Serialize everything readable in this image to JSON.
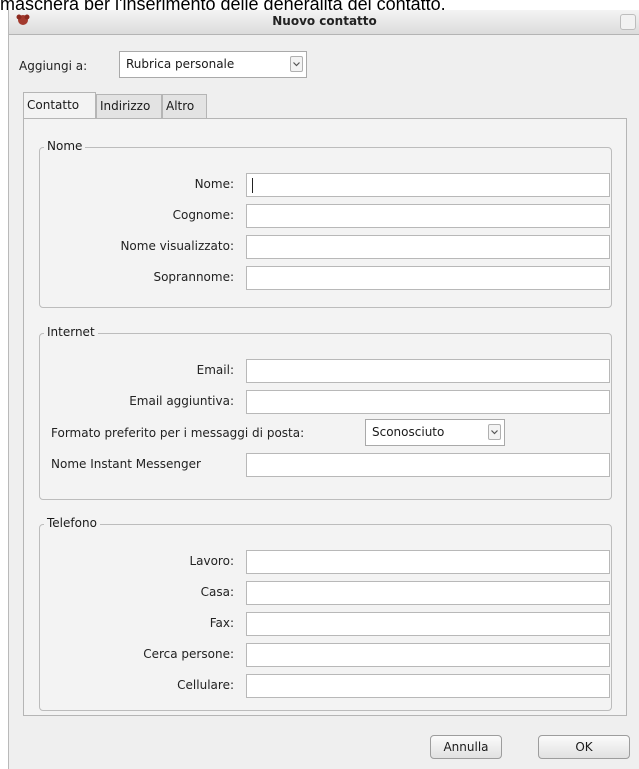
{
  "caption": "maschera per l'inserimento delle generalità del contatto.",
  "window": {
    "title": "Nuovo contatto"
  },
  "top": {
    "label": "Aggiungi a:",
    "selected": "Rubrica personale"
  },
  "tabs": [
    {
      "label": "Contatto",
      "active": true
    },
    {
      "label": "Indirizzo",
      "active": false
    },
    {
      "label": "Altro",
      "active": false
    }
  ],
  "nome_group": {
    "legend": "Nome",
    "fields": [
      {
        "label": "Nome:",
        "value": ""
      },
      {
        "label": "Cognome:",
        "value": ""
      },
      {
        "label": "Nome visualizzato:",
        "value": ""
      },
      {
        "label": "Soprannome:",
        "value": ""
      }
    ]
  },
  "internet_group": {
    "legend": "Internet",
    "email_label": "Email:",
    "email2_label": "Email aggiuntiva:",
    "format_label": "Formato preferito per i messaggi di posta:",
    "format_selected": "Sconosciuto",
    "im_label": "Nome Instant Messenger"
  },
  "telefono_group": {
    "legend": "Telefono",
    "fields": [
      {
        "label": "Lavoro:",
        "value": ""
      },
      {
        "label": "Casa:",
        "value": ""
      },
      {
        "label": "Fax:",
        "value": ""
      },
      {
        "label": "Cerca persone:",
        "value": ""
      },
      {
        "label": "Cellulare:",
        "value": ""
      }
    ]
  },
  "buttons": {
    "cancel": "Annulla",
    "ok": "OK"
  },
  "colors": {
    "window_bg": "#efefef",
    "app_icon": "#a33a2e"
  }
}
